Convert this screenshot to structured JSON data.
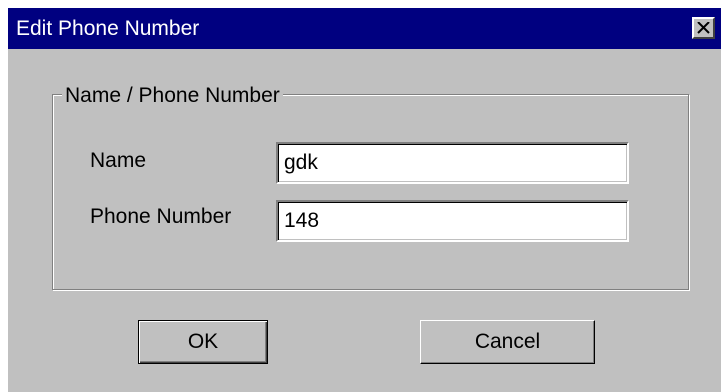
{
  "window": {
    "title": "Edit Phone Number",
    "close_icon": "close-x-icon"
  },
  "group": {
    "legend": "Name / Phone Number"
  },
  "fields": {
    "name": {
      "label": "Name",
      "value": "gdk"
    },
    "phone": {
      "label": "Phone Number",
      "value": "148"
    }
  },
  "buttons": {
    "ok_label": "OK",
    "cancel_label": "Cancel"
  },
  "colors": {
    "titlebar": "#000080",
    "face": "#c0c0c0"
  }
}
